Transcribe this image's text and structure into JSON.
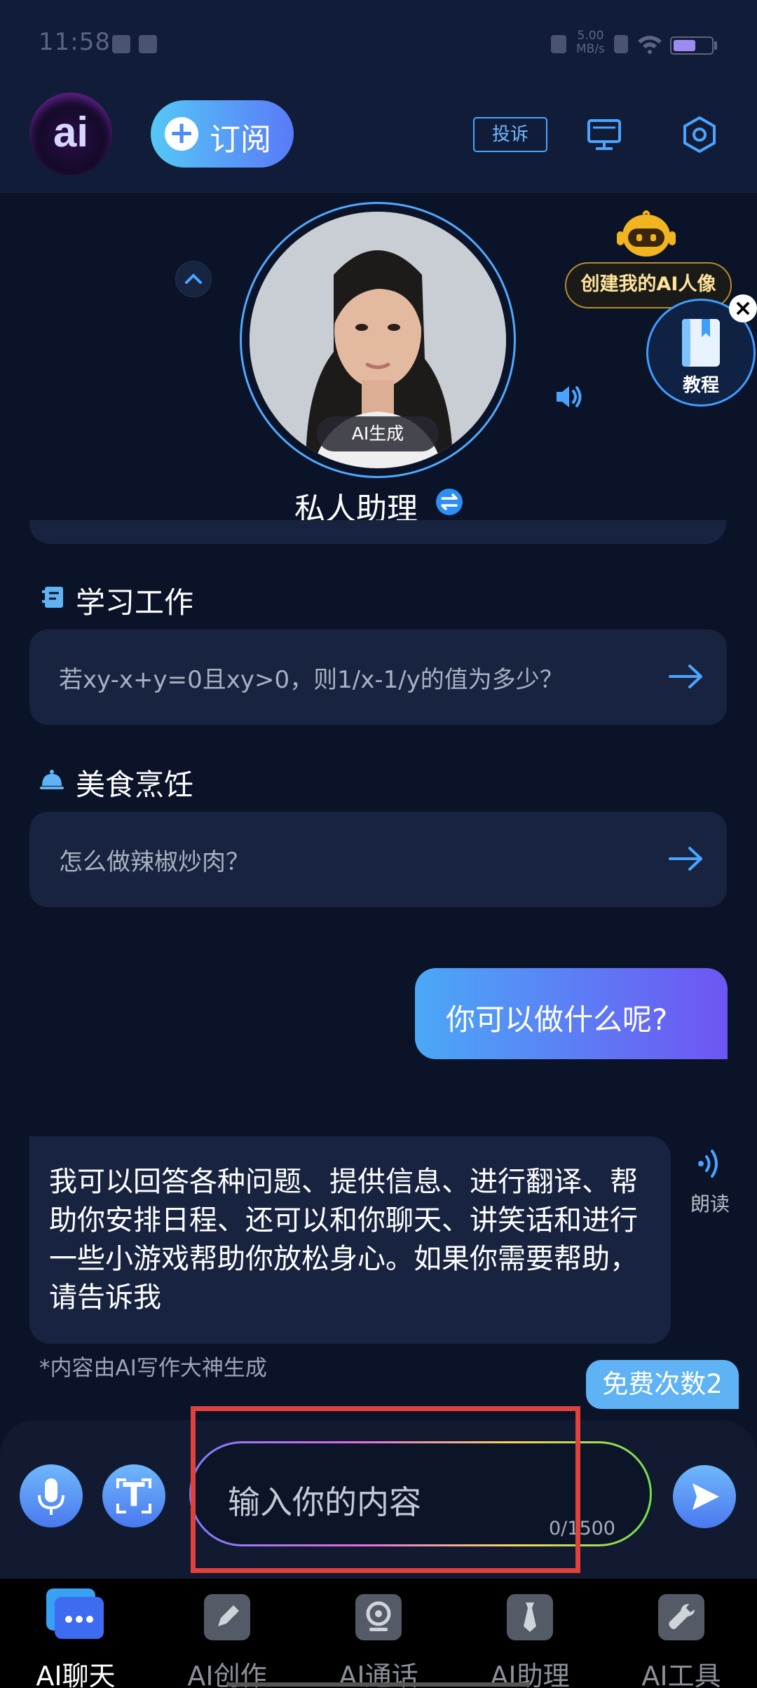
{
  "status_bar": {
    "time": "11:58",
    "net_speed_value": "5.00",
    "net_speed_unit": "MB/s"
  },
  "header": {
    "logo_text": "ai",
    "subscribe_label": "订阅",
    "complain_label": "投诉",
    "icons": [
      "screen-cast-icon",
      "settings-icon"
    ]
  },
  "assistant": {
    "badge": "AI生成",
    "name": "私人助理",
    "create_ai_label": "创建我的AI人像",
    "tutorial_label": "教程",
    "close_glyph": "×"
  },
  "suggestions": [
    {
      "category": "学习工作",
      "icon": "notebook-icon",
      "prompt": "若xy-x+y=0且xy>0，则1/x-1/y的值为多少？"
    },
    {
      "category": "美食烹饪",
      "icon": "dish-cover-icon",
      "prompt": "怎么做辣椒炒肉？"
    }
  ],
  "chat": {
    "user_message": "你可以做什么呢?",
    "ai_message": "我可以回答各种问题、提供信息、进行翻译、帮助你安排日程、还可以和你聊天、讲笑话和进行一些小游戏帮助你放松身心。如果你需要帮助，请告诉我",
    "read_aloud_label": "朗读",
    "ai_note": "*内容由AI写作大神生成",
    "free_count_label": "免费次数2"
  },
  "input": {
    "placeholder": "输入你的内容",
    "counter": "0/1500",
    "text_button_glyph": "T"
  },
  "tabs": [
    {
      "label": "AI聊天",
      "icon": "chat-bubble-icon",
      "active": true
    },
    {
      "label": "AI创作",
      "icon": "pencil-icon",
      "active": false
    },
    {
      "label": "AI通话",
      "icon": "webcam-icon",
      "active": false
    },
    {
      "label": "AI助理",
      "icon": "necktie-icon",
      "active": false
    },
    {
      "label": "AI工具",
      "icon": "wrench-icon",
      "active": false
    }
  ],
  "colors": {
    "background": "#0b1328",
    "card": "#17233f",
    "accent_blue": "#4aa9f7",
    "accent_purple": "#6e55f3",
    "highlight": "#e0413b"
  },
  "battery_level": 0.6
}
